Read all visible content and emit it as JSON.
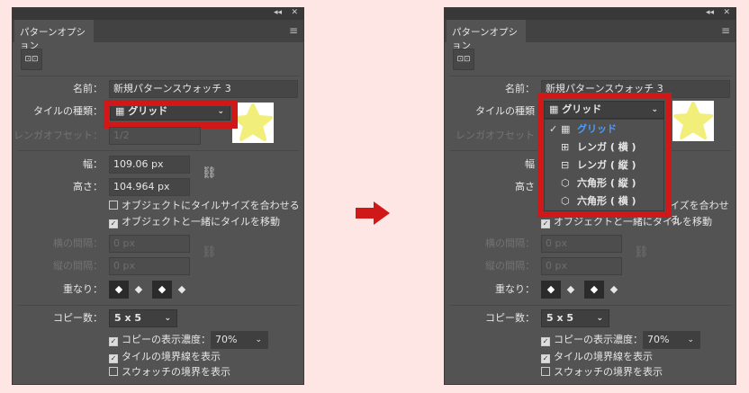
{
  "panel": {
    "title": "パターンオプション",
    "collapse_icon": "◂◂",
    "close_icon": "✕",
    "menu_icon": "≡",
    "name_label": "名前：",
    "name_value": "新規パターンスウォッチ 3",
    "tile_type_label": "タイルの種類：",
    "tile_type_label_open": "タイルの種類",
    "tile_type_value": "グリッド",
    "brick_offset_label": "レンガオフセット：",
    "brick_offset_label_open": "レンガオフセット",
    "brick_offset_value": "1/2",
    "width_label": "幅：",
    "width_label_open": "幅",
    "width_value": "109.06 px",
    "height_label": "高さ：",
    "height_label_open": "高さ",
    "height_value": "104.964 px",
    "fit_tile": "オブジェクトにタイルサイズを合わせる",
    "fit_tile_open": "イズを合わせる",
    "move_tile": "オブジェクトと一緒にタイルを移動",
    "h_spacing_label": "横の間隔：",
    "h_spacing_value": "0 px",
    "v_spacing_label": "縦の間隔：",
    "v_spacing_value": "0 px",
    "overlap_label": "重なり：",
    "copies_label": "コピー数：",
    "copies_value": "5 x 5",
    "dim_label": "コピーの表示濃度：",
    "dim_value": "70%",
    "show_tile_edge": "タイルの境界線を表示",
    "show_swatch_bounds": "スウォッチの境界を表示"
  },
  "dropdown": {
    "items": [
      {
        "icon": "▦",
        "label": "グリッド",
        "selected": true
      },
      {
        "icon": "⊞",
        "label": "レンガ ( 横 )"
      },
      {
        "icon": "⊟",
        "label": "レンガ ( 縦 )"
      },
      {
        "icon": "⬡",
        "label": "六角形 ( 縦 )"
      },
      {
        "icon": "⬡",
        "label": "六角形 ( 横 )"
      }
    ]
  },
  "colors": {
    "highlight": "#d01818",
    "selected_item": "#4a9cff",
    "arrow": "#d01818",
    "star": "#f2ee7a"
  }
}
